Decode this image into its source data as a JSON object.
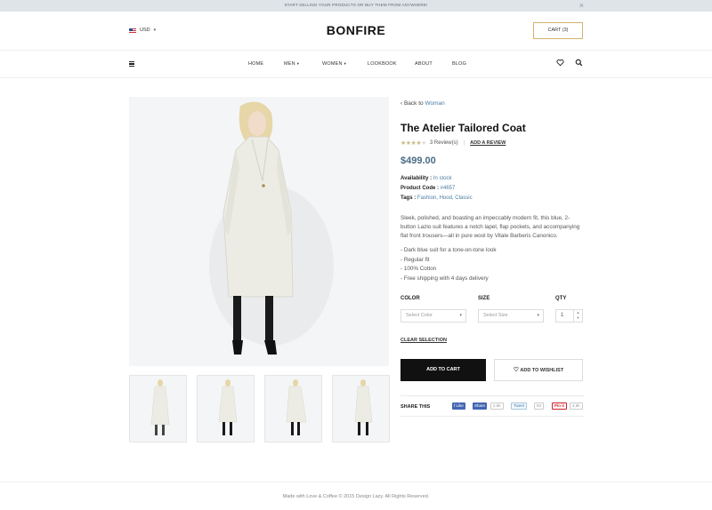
{
  "topbar": {
    "message": "START SELLING YOUR PRODUCTS OR BUY THEM FROM ANYWHERE!",
    "close": "×"
  },
  "header": {
    "currency": "USD",
    "logo": "BONFIRE",
    "cart_label": "CART (3)"
  },
  "nav": {
    "items": [
      "HOME",
      "MEN",
      "WOMEN",
      "LOOKBOOK",
      "ABOUT",
      "BLOG"
    ]
  },
  "breadcrumb": {
    "back_prefix": "‹ Back to ",
    "back_target": "Woman"
  },
  "product": {
    "title": "The Atelier Tailored Coat",
    "rating": 4,
    "rating_max": 5,
    "reviews": "3 Review(s)",
    "add_review": "ADD A REVIEW",
    "price": "$499.00",
    "availability_label": "Availability :",
    "availability_value": "In stock",
    "code_label": "Product Code :",
    "code_value": "#4657",
    "tags_label": "Tags :",
    "tags_value": "Fashion, Hood, Classic",
    "description": "Sleek, polished, and boasting an impeccably modern fit, this blue, 2-button Lazio suit features a notch lapel, flap pockets, and accompanying flat front trousers—all in pure wool by Vitale Barberis Canonico.",
    "features": [
      "Dark blue suit for a tone-on-tone look",
      "Regular fit",
      "100% Cotton",
      "Free shipping with 4 days delivery"
    ]
  },
  "options": {
    "color_label": "COLOR",
    "color_placeholder": "Select Color",
    "size_label": "SIZE",
    "size_placeholder": "Select Size",
    "qty_label": "QTY",
    "qty_value": "1",
    "clear": "CLEAR SELECTION"
  },
  "actions": {
    "add_to_cart": "ADD TO CART",
    "add_to_wishlist": "ADD TO WISHLIST"
  },
  "share": {
    "label": "SHARE THIS",
    "fb_like": "f Like",
    "fb_share": "Share",
    "fb_count": "2.6k",
    "tweet": "Tweet",
    "tweet_count": "83",
    "pin": "Pin it",
    "pin_count": "4.5k"
  },
  "footer": {
    "text": "Made with Love & Coffee © 2015 Design Lazy. All Rights Reserved."
  },
  "colors": {
    "accent": "#4a7da3",
    "price": "#4a6b85",
    "cart_border": "#d3b36a",
    "topbar": "#dfe4e8"
  }
}
